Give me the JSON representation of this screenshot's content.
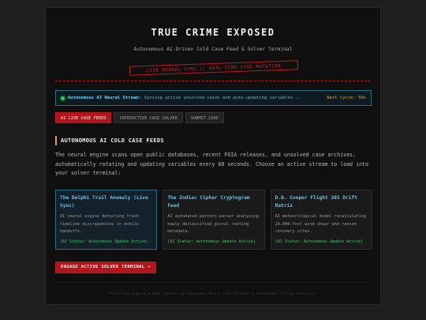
{
  "header": {
    "title": "TRUE CRIME EXPOSED",
    "subtitle": "Autonomous AI-Driven Cold Case Feed & Solver Terminal",
    "stamp": "LIVE NEURAL SYNC // REAL-TIME CASE MUTATION"
  },
  "status_bar": {
    "label": "Autonomous AI Neural Stream:",
    "message": "Syncing active unsolved cases and auto-updating variables...",
    "cycle": "Next Cycle: 59s"
  },
  "tabs": [
    {
      "label": "AI LIVE CASE FEEDS",
      "active": true
    },
    {
      "label": "INTERACTIVE CASE SOLVER",
      "active": false
    },
    {
      "label": "SUBMIT LEAD",
      "active": false
    }
  ],
  "section": {
    "heading": "AUTONOMOUS AI COLD CASE FEEDS",
    "intro": "The neural engine scans open public databases, recent FOIA releases, and unsolved case archives, automatically rotating and updating variables every 60 seconds. Choose an active stream to load into your solver terminal:"
  },
  "cards": [
    {
      "title": "The Delphi Trail Anomaly (Live Sync)",
      "desc": "AI neural engine detecting fresh timeline discrepancies in mobile handoffs.",
      "status": "[AI Status: Autonomous Update Active]"
    },
    {
      "title": "The Zodiac Cipher Cryptogram Feed",
      "desc": "AI automated pattern parser analyzing newly declassified postal routing metadata.",
      "status": "[AI Status: Autonomous Update Active]"
    },
    {
      "title": "D.B. Cooper Flight 305 Drift Matrix",
      "desc": "AI meteorological model recalculating 10,000-foot wind shear and ransom recovery sites.",
      "status": "[AI Status: Autonomous Update Active]"
    }
  ],
  "engage_button": "ENGAGE ACTIVE SOLVER TERMINAL →",
  "footer": "True Crime Exposed © 2026. Powered by Autonomous Neural Case Mutation & Independent Citizen Analytics.",
  "colors": {
    "accent_red": "#b3161a",
    "accent_cyan": "#55c8ef",
    "accent_gold": "#d5a247",
    "status_green": "#1fd35c"
  }
}
